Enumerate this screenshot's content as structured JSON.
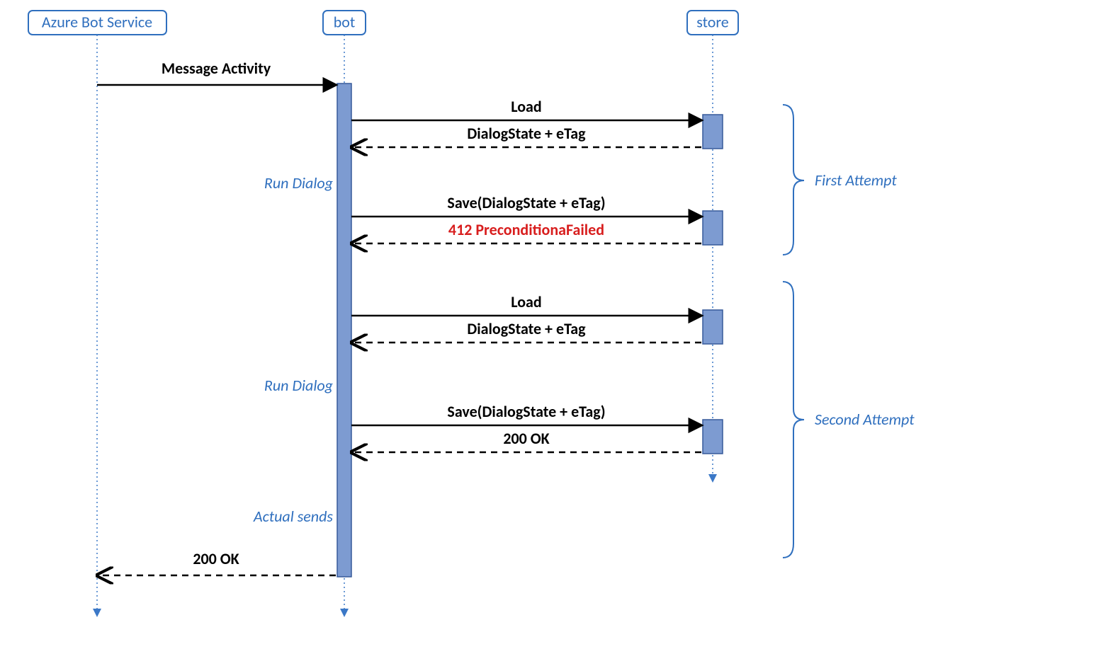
{
  "actors": {
    "azure": "Azure Bot Service",
    "bot": "bot",
    "store": "store"
  },
  "messages": {
    "message_activity": "Message Activity",
    "load1": "Load",
    "dialogstate_etag1": "DialogState + eTag",
    "run_dialog1": "Run Dialog",
    "save1": "Save(DialogState + eTag)",
    "precondition_failed": "412 PreconditionaFailed",
    "load2": "Load",
    "dialogstate_etag2": "DialogState + eTag",
    "run_dialog2": "Run Dialog",
    "save2": "Save(DialogState + eTag)",
    "ok200": "200 OK",
    "actual_sends": "Actual sends",
    "return200": "200 OK"
  },
  "groups": {
    "first": "First Attempt",
    "second": "Second Attempt"
  },
  "chart_data": {
    "type": "sequence-diagram",
    "actors": [
      "Azure Bot Service",
      "bot",
      "store"
    ],
    "interactions": [
      {
        "from": "Azure Bot Service",
        "to": "bot",
        "label": "Message Activity",
        "style": "solid"
      },
      {
        "from": "bot",
        "to": "store",
        "label": "Load",
        "style": "solid",
        "group": "First Attempt"
      },
      {
        "from": "store",
        "to": "bot",
        "label": "DialogState + eTag",
        "style": "dashed",
        "group": "First Attempt"
      },
      {
        "note_on": "bot",
        "label": "Run Dialog",
        "group": "First Attempt"
      },
      {
        "from": "bot",
        "to": "store",
        "label": "Save(DialogState + eTag)",
        "style": "solid",
        "group": "First Attempt"
      },
      {
        "from": "store",
        "to": "bot",
        "label": "412 PreconditionaFailed",
        "style": "dashed",
        "status": "error",
        "group": "First Attempt"
      },
      {
        "from": "bot",
        "to": "store",
        "label": "Load",
        "style": "solid",
        "group": "Second Attempt"
      },
      {
        "from": "store",
        "to": "bot",
        "label": "DialogState + eTag",
        "style": "dashed",
        "group": "Second Attempt"
      },
      {
        "note_on": "bot",
        "label": "Run Dialog",
        "group": "Second Attempt"
      },
      {
        "from": "bot",
        "to": "store",
        "label": "Save(DialogState + eTag)",
        "style": "solid",
        "group": "Second Attempt"
      },
      {
        "from": "store",
        "to": "bot",
        "label": "200 OK",
        "style": "dashed",
        "group": "Second Attempt"
      },
      {
        "note_on": "bot",
        "label": "Actual sends",
        "group": "Second Attempt"
      },
      {
        "from": "bot",
        "to": "Azure Bot Service",
        "label": "200 OK",
        "style": "dashed"
      }
    ]
  }
}
